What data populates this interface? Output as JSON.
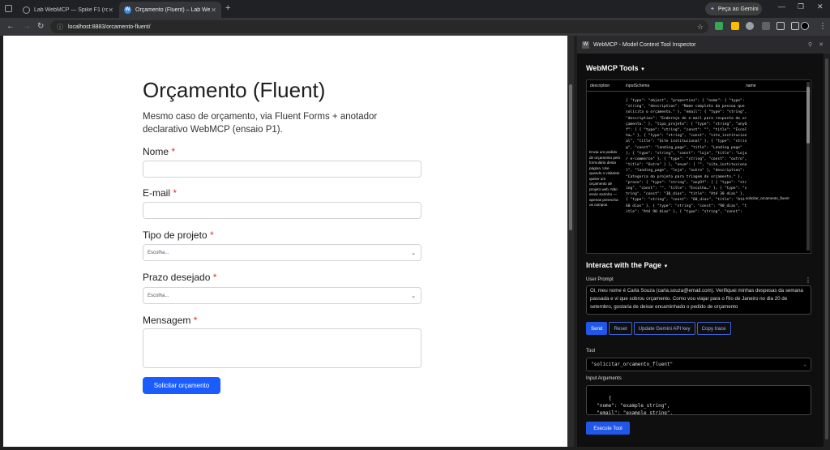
{
  "browser": {
    "tabs": [
      {
        "label": "Lab WebMCP — Spike F1 (rom"
      },
      {
        "label": "Orçamento (Fluent) – Lab Web"
      }
    ],
    "gemini_button": "Peça ao Gemini",
    "address": "localhost:8883/orcamento-fluent/"
  },
  "form": {
    "title": "Orçamento (Fluent)",
    "subtitle": "Mesmo caso de orçamento, via Fluent Forms + anotador declarativo WebMCP (ensaio P1).",
    "required_mark": "*",
    "name_label": "Nome",
    "email_label": "E-mail",
    "type_label": "Tipo de projeto",
    "type_value": "Escolha...",
    "deadline_label": "Prazo desejado",
    "deadline_value": "Escolha...",
    "message_label": "Mensagem",
    "submit": "Solicitar orçamento"
  },
  "inspector": {
    "title": "WebMCP - Model Context Tool Inspector",
    "tools_heading": "WebMCP Tools",
    "columns": {
      "description": "description",
      "schema": "inputSchema",
      "name": "name"
    },
    "tool_description": "Envia um pedido de orçamento pelo formulário desta página. Use quando o visitante quiser um orçamento de projeto web. Não envie sozinho — apenas preencha os campos.",
    "tool_schema": "{ \"type\": \"object\", \"properties\": { \"nome\": { \"type\": \"string\", \"description\": \"Nome completo da pessoa que solicita o orçamento.\" }, \"email\": { \"type\": \"string\", \"description\": \"Endereço de e-mail para resposta do orçamento.\" }, \"tipo_projeto\": { \"type\": \"string\", \"anyOf\": [ { \"type\": \"string\", \"const\": \"\", \"title\": \"Escolha…\" }, { \"type\": \"string\", \"const\": \"site_institucional\", \"title\": \"Site institucional\" }, { \"type\": \"string\", \"const\": \"landing_page\", \"title\": \"Landing page\" }, { \"type\": \"string\", \"const\": \"loja\", \"title\": \"Loja / e-commerce\" }, { \"type\": \"string\", \"const\": \"outro\", \"title\": \"Outro\" } ], \"enum\": [ \"\", \"site_institucional\", \"landing_page\", \"loja\", \"outro\" ], \"description\": \"Categoria do projeto para triagem do orçamento.\" }, \"prazo\": { \"type\": \"string\", \"anyOf\": [ { \"type\": \"string\", \"const\": \"\", \"title\": \"Escolha…\" }, { \"type\": \"string\", \"const\": \"30_dias\", \"title\": \"Até 30 dias\" }, { \"type\": \"string\", \"const\": \"60_dias\", \"title\": \"Até 60 dias\" }, { \"type\": \"string\", \"const\": \"90_dias\", \"title\": \"Até 90 dias\" }, { \"type\": \"string\", \"const\": ",
    "tool_name": "solicitar_orcamento_fluent",
    "interact_heading": "Interact with the Page",
    "prompt_label": "User Prompt",
    "prompt_text": "Oi, meu nome é Carla Souza (carla.souza@email.com). Verifiquei minhas despesas da semana passada e vi que sobrou orçamento. Como vou viajar para o Rio de Janeiro no dia 20 de setembro, gostaria de deixar encaminhado o pedido de orçamento",
    "buttons": {
      "send": "Send",
      "reset": "Reset",
      "update_key": "Update Gemini API key",
      "copy_trace": "Copy trace"
    },
    "tool_label": "Tool",
    "tool_selected": "\"solicitar_orcamento_fluent\"",
    "args_label": "Input Arguments",
    "args_text": "{\n  \"nome\": \"example_string\",\n  \"email\": \"example_string\",",
    "execute": "Execute Tool"
  }
}
